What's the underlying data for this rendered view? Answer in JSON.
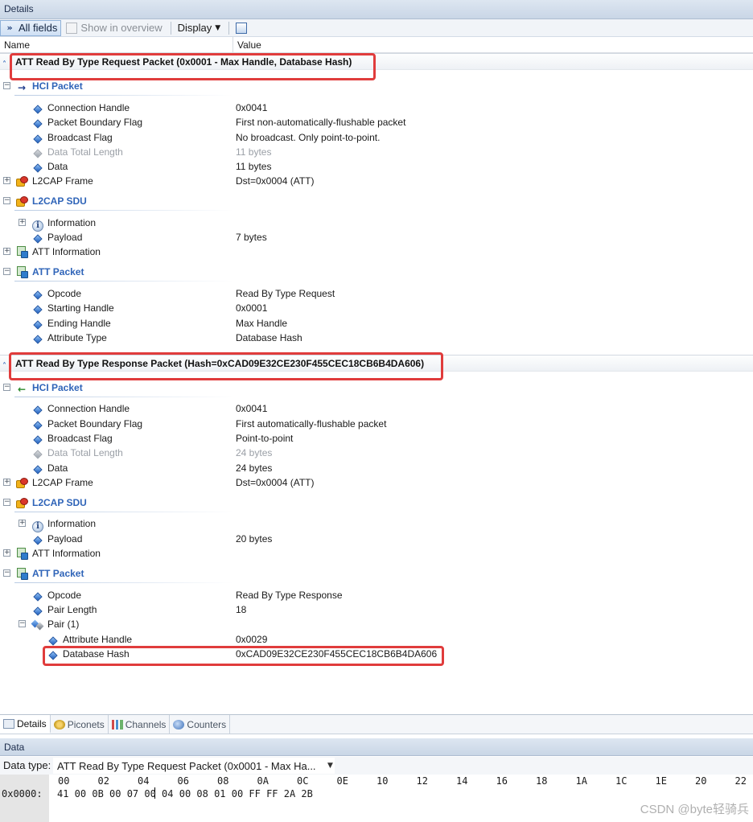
{
  "panel_title": "Details",
  "toolbar": {
    "all_fields": "All fields",
    "show_in_overview": "Show in overview",
    "display": "Display"
  },
  "columns": {
    "name": "Name",
    "value": "Value"
  },
  "packet1": {
    "title": "ATT Read By Type Request Packet (0x0001 - Max Handle, Database Hash)",
    "hci": {
      "label": "HCI Packet",
      "fields": [
        {
          "name": "Connection Handle",
          "value": "0x0041"
        },
        {
          "name": "Packet Boundary Flag",
          "value": "First non-automatically-flushable packet"
        },
        {
          "name": "Broadcast Flag",
          "value": "No broadcast. Only point-to-point."
        },
        {
          "name": "Data Total Length",
          "value": "11 bytes"
        },
        {
          "name": "Data",
          "value": "11 bytes"
        }
      ]
    },
    "l2cap_frame": {
      "label": "L2CAP Frame",
      "value": "Dst=0x0004 (ATT)"
    },
    "l2cap_sdu": {
      "label": "L2CAP SDU",
      "information": "Information",
      "payload": {
        "name": "Payload",
        "value": "7 bytes"
      }
    },
    "att_information": "ATT Information",
    "att_packet": {
      "label": "ATT Packet",
      "fields": [
        {
          "name": "Opcode",
          "value": "Read By Type Request"
        },
        {
          "name": "Starting Handle",
          "value": "0x0001"
        },
        {
          "name": "Ending Handle",
          "value": "Max Handle"
        },
        {
          "name": "Attribute Type",
          "value": "Database Hash"
        }
      ]
    }
  },
  "packet2": {
    "title": "ATT Read By Type Response Packet (Hash=0xCAD09E32CE230F455CEC18CB6B4DA606)",
    "hci": {
      "label": "HCI Packet",
      "fields": [
        {
          "name": "Connection Handle",
          "value": "0x0041"
        },
        {
          "name": "Packet Boundary Flag",
          "value": "First automatically-flushable packet"
        },
        {
          "name": "Broadcast Flag",
          "value": "Point-to-point"
        },
        {
          "name": "Data Total Length",
          "value": "24 bytes"
        },
        {
          "name": "Data",
          "value": "24 bytes"
        }
      ]
    },
    "l2cap_frame": {
      "label": "L2CAP Frame",
      "value": "Dst=0x0004 (ATT)"
    },
    "l2cap_sdu": {
      "label": "L2CAP SDU",
      "information": "Information",
      "payload": {
        "name": "Payload",
        "value": "20 bytes"
      }
    },
    "att_information": "ATT Information",
    "att_packet": {
      "label": "ATT Packet",
      "fields": [
        {
          "name": "Opcode",
          "value": "Read By Type Response"
        },
        {
          "name": "Pair Length",
          "value": "18"
        }
      ],
      "pair": {
        "label": "Pair (1)",
        "fields": [
          {
            "name": "Attribute Handle",
            "value": "0x0029"
          },
          {
            "name": "Database Hash",
            "value": "0xCAD09E32CE230F455CEC18CB6B4DA606"
          }
        ]
      }
    }
  },
  "bottom_tabs": [
    "Details",
    "Piconets",
    "Channels",
    "Counters"
  ],
  "data_panel": {
    "title": "Data",
    "data_type_label": "Data type:",
    "data_type_value": "ATT Read By Type Request Packet (0x0001 - Max Ha...",
    "columns": [
      "00",
      "02",
      "04",
      "06",
      "08",
      "0A",
      "0C",
      "0E",
      "10",
      "12",
      "14",
      "16",
      "18",
      "1A",
      "1C",
      "1E",
      "20",
      "22"
    ],
    "row_address": "0x0000:",
    "row_bytes": "41 00 0B 00 07 00 04 00 08 01 00 FF FF 2A 2B"
  },
  "watermark": "CSDN @byte轻骑兵",
  "colors": {
    "highlight": "#e03c3c",
    "group_label": "#2f64b8"
  }
}
